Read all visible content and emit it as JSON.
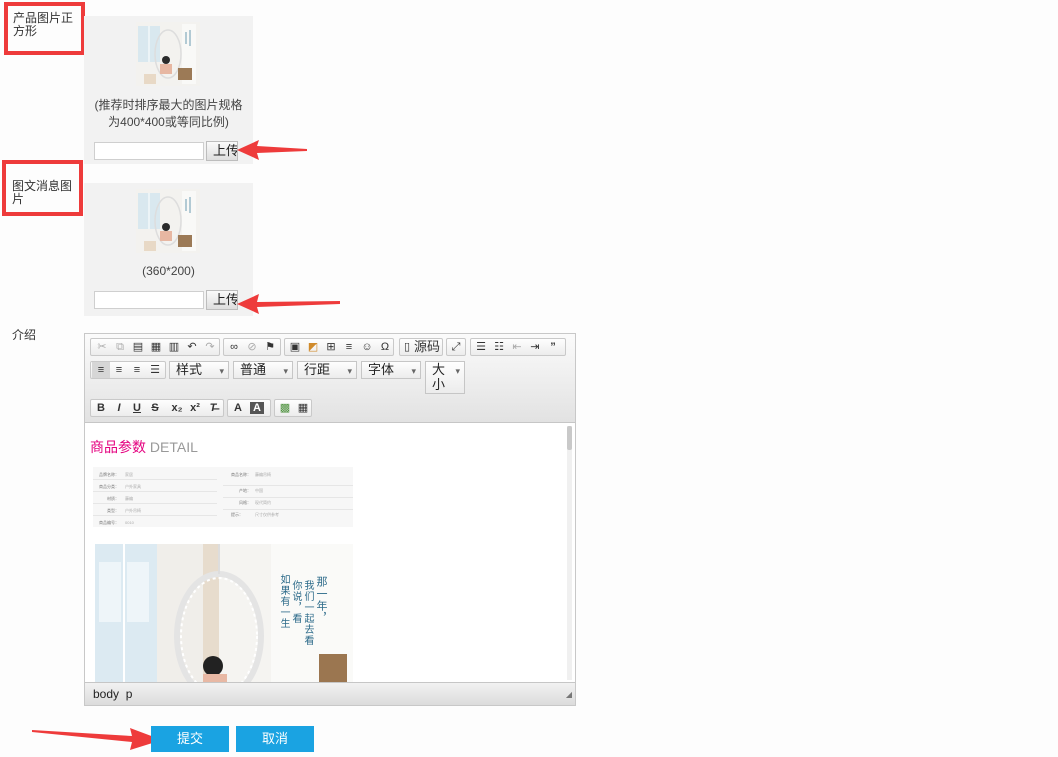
{
  "product_image": {
    "label": "产品图片正方形",
    "hint": "(推荐时排序最大的图片规格为400*400或等同比例)",
    "input_value": "",
    "upload_label": "上传"
  },
  "news_image": {
    "label": "图文消息图片",
    "hint": "(360*200)",
    "input_value": "",
    "upload_label": "上传"
  },
  "intro": {
    "label": "介绍"
  },
  "editor": {
    "source_label": "源码",
    "style_label": "样式",
    "normal_label": "普通",
    "line_height_label": "行距",
    "font_label": "字体",
    "size_label": "大小",
    "content": {
      "heading_cn": "商品参数",
      "heading_en": "DETAIL",
      "params": [
        {
          "k": "品牌名称：",
          "v": "家居"
        },
        {
          "k": "商品分类：",
          "v": "户外家具"
        },
        {
          "k": "材质：",
          "v": "藤编"
        },
        {
          "k": "类型：",
          "v": "户外吊椅"
        },
        {
          "k": "商品编号：",
          "v": "0010"
        },
        {
          "k": "商品名称：",
          "v": "藤编吊椅"
        },
        {
          "k": "产地：",
          "v": "中国"
        },
        {
          "k": "风格：",
          "v": "现代简约"
        },
        {
          "k": "提示：",
          "v": "尺寸仅供参考"
        }
      ],
      "poem_line_1": "那一年，",
      "poem_line_2": "我们一起去看",
      "poem_line_3": "你说，看",
      "poem_line_4": "如果有一生"
    },
    "status_path": "body  p"
  },
  "buttons": {
    "submit": "提交",
    "cancel": "取消"
  },
  "colors": {
    "accent": "#1aa3e2",
    "highlight": "#ee3b3b",
    "heading": "#e4007f"
  }
}
